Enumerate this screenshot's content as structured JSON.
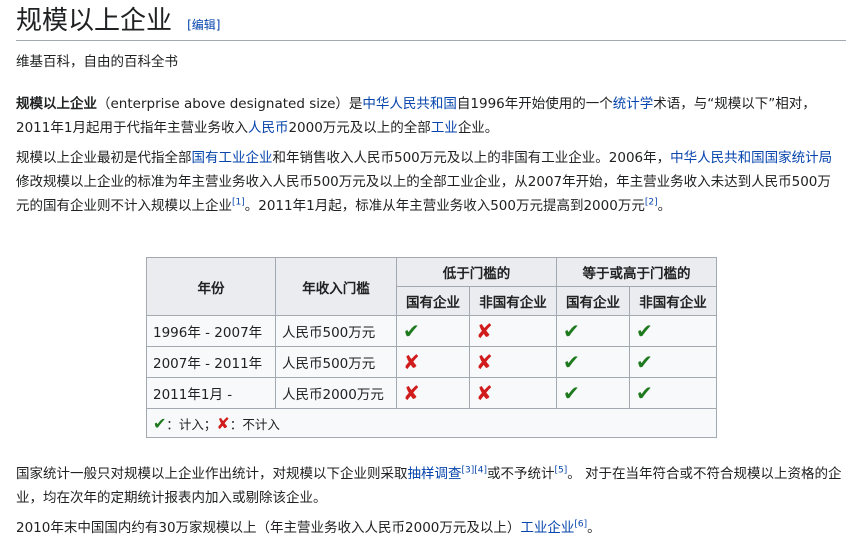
{
  "page": {
    "title": "规模以上企业",
    "edit_label": "[编辑]",
    "tagline": "维基百科，自由的百科全书"
  },
  "p1": {
    "term": "规模以上企业",
    "t1": "（enterprise above designated size）是",
    "link1": "中华人民共和国",
    "t2": "自1996年开始使用的一个",
    "link2": "统计学",
    "t3": "术语，与“规模以下”相对，2011年1月起用于代指年主营业务收入",
    "link3": "人民币",
    "t4": "2000万元及以上的全部",
    "link4": "工业",
    "t5": "企业。"
  },
  "p2": {
    "t1": "规模以上企业最初是代指全部",
    "link1": "国有工业企业",
    "t2": "和年销售收入人民币500万元及以上的非国有工业企业。2006年，",
    "link2": "中华人民共和国国家统计局",
    "t3": "修改规模以上企业的标准为年主营业务收入人民币500万元及以上的全部工业企业，从2007年开始，年主营业务收入未达到人民币500万元的国有企业则不计入规模以上企业",
    "ref1": "[1]",
    "t4": "。2011年1月起，标准从年主营业务收入500万元提高到2000万元",
    "ref2": "[2]",
    "t5": "。"
  },
  "table": {
    "h_year": "年份",
    "h_threshold": "年收入门槛",
    "h_below": "低于门槛的",
    "h_above": "等于或高于门槛的",
    "h_state": "国有企业",
    "h_nonstate": "非国有企业",
    "rows": [
      {
        "year": "1996年 - 2007年",
        "threshold": "人民币500万元",
        "marks": [
          "check",
          "cross",
          "check",
          "check"
        ]
      },
      {
        "year": "2007年 - 2011年",
        "threshold": "人民币500万元",
        "marks": [
          "cross",
          "cross",
          "check",
          "check"
        ]
      },
      {
        "year": "2011年1月 -",
        "threshold": "人民币2000万元",
        "marks": [
          "cross",
          "cross",
          "check",
          "check"
        ]
      }
    ],
    "legend_counted": "：计入；",
    "legend_not": "：不计入"
  },
  "p3": {
    "t1": "国家统计一般只对规模以上企业作出统计，对规模以下企业则采取",
    "link1": "抽样调查",
    "ref1": "[3][4]",
    "t2": "或不予统计",
    "ref2": "[5]",
    "t3": "。 对于在当年符合或不符合规模以上资格的企业，均在次年的定期统计报表内加入或剔除该企业。"
  },
  "p4": {
    "t1": "2010年末中国国内约有30万家规模以上（年主营业务收入人民币2000万元及以上）",
    "link1": "工业企业",
    "ref1": "[6]",
    "t2": "。"
  },
  "icons": {
    "check": "✔",
    "cross": "✘"
  }
}
